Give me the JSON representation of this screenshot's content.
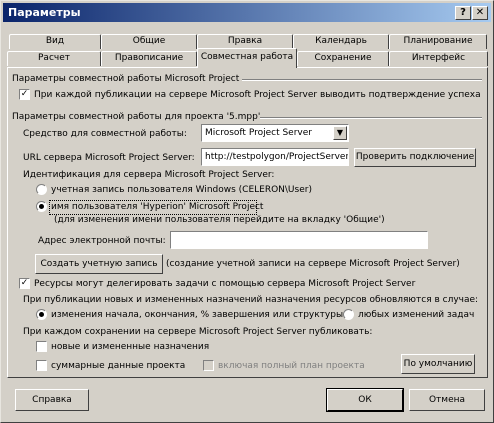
{
  "window": {
    "title": "Параметры",
    "help_button": "?",
    "close_button": "✕"
  },
  "tabs_back": [
    {
      "label": "Вид"
    },
    {
      "label": "Общие"
    },
    {
      "label": "Правка"
    },
    {
      "label": "Календарь"
    },
    {
      "label": "Планирование"
    }
  ],
  "tabs_front": [
    {
      "label": "Расчет"
    },
    {
      "label": "Правописание"
    },
    {
      "label": "Совместная работа"
    },
    {
      "label": "Сохранение"
    },
    {
      "label": "Интерфейс"
    }
  ],
  "section_global": {
    "header": "Параметры совместной работы Microsoft Project",
    "publish_checkbox_label": "При каждой публикации на сервере Microsoft Project Server выводить подтверждение успеха",
    "publish_checked": true
  },
  "section_project": {
    "header": "Параметры совместной работы для проекта '5.mpp'",
    "collab_means_label": "Средство для совместной работы:",
    "collab_means_value": "Microsoft Project Server",
    "url_label": "URL сервера Microsoft Project Server:",
    "url_value": "http://testpolygon/ProjectServer",
    "test_connection_button": "Проверить подключение",
    "identification_label": "Идентификация для сервера Microsoft Project Server:",
    "radio_windows_label": "учетная запись пользователя Windows (CELERON\\User)",
    "radio_windows_checked": false,
    "radio_project_label": "имя пользователя 'Hyperion' Microsoft Project",
    "radio_project_checked": true,
    "radio_project_note": "(для изменения имени пользователя перейдите на вкладку 'Общие')",
    "email_label": "Адрес электронной почты:",
    "email_value": "",
    "create_account_button": "Создать учетную запись",
    "create_account_note": "(создание учетной записи на сервере Microsoft Project Server)",
    "delegate_label": "Ресурсы могут делегировать задачи с помощью сервера Microsoft Project Server",
    "delegate_checked": true,
    "publish_new_label": "При публикации новых и измененных назначений назначения ресурсов обновляются в случае:",
    "radio_changes_label": "изменения начала, окончания, % завершения или структуры",
    "radio_changes_checked": true,
    "radio_any_label": "любых изменений задач",
    "radio_any_checked": false,
    "on_save_label": "При каждом сохранении на сервере Microsoft Project Server публиковать:",
    "chk_new_changed_label": "новые и измененные назначения",
    "chk_summary_label": "суммарные данные проекта",
    "chk_full_plan_label": "включая полный план проекта",
    "defaults_button": "По умолчанию"
  },
  "footer": {
    "help_button": "Справка",
    "ok_button": "ОК",
    "cancel_button": "Отмена"
  }
}
